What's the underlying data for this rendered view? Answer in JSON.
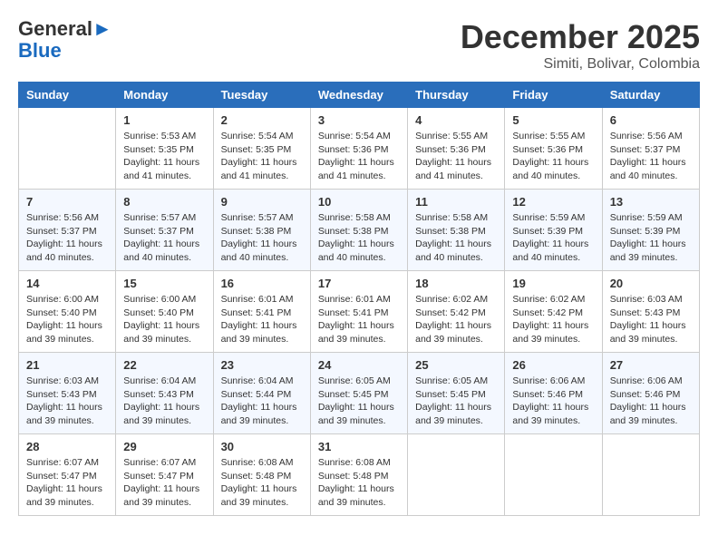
{
  "header": {
    "logo_general": "General",
    "logo_blue": "Blue",
    "month_year": "December 2025",
    "location": "Simiti, Bolivar, Colombia"
  },
  "days_of_week": [
    "Sunday",
    "Monday",
    "Tuesday",
    "Wednesday",
    "Thursday",
    "Friday",
    "Saturday"
  ],
  "weeks": [
    [
      {
        "num": "",
        "info": ""
      },
      {
        "num": "1",
        "info": "Sunrise: 5:53 AM\nSunset: 5:35 PM\nDaylight: 11 hours and 41 minutes."
      },
      {
        "num": "2",
        "info": "Sunrise: 5:54 AM\nSunset: 5:35 PM\nDaylight: 11 hours and 41 minutes."
      },
      {
        "num": "3",
        "info": "Sunrise: 5:54 AM\nSunset: 5:36 PM\nDaylight: 11 hours and 41 minutes."
      },
      {
        "num": "4",
        "info": "Sunrise: 5:55 AM\nSunset: 5:36 PM\nDaylight: 11 hours and 41 minutes."
      },
      {
        "num": "5",
        "info": "Sunrise: 5:55 AM\nSunset: 5:36 PM\nDaylight: 11 hours and 40 minutes."
      },
      {
        "num": "6",
        "info": "Sunrise: 5:56 AM\nSunset: 5:37 PM\nDaylight: 11 hours and 40 minutes."
      }
    ],
    [
      {
        "num": "7",
        "info": "Sunrise: 5:56 AM\nSunset: 5:37 PM\nDaylight: 11 hours and 40 minutes."
      },
      {
        "num": "8",
        "info": "Sunrise: 5:57 AM\nSunset: 5:37 PM\nDaylight: 11 hours and 40 minutes."
      },
      {
        "num": "9",
        "info": "Sunrise: 5:57 AM\nSunset: 5:38 PM\nDaylight: 11 hours and 40 minutes."
      },
      {
        "num": "10",
        "info": "Sunrise: 5:58 AM\nSunset: 5:38 PM\nDaylight: 11 hours and 40 minutes."
      },
      {
        "num": "11",
        "info": "Sunrise: 5:58 AM\nSunset: 5:38 PM\nDaylight: 11 hours and 40 minutes."
      },
      {
        "num": "12",
        "info": "Sunrise: 5:59 AM\nSunset: 5:39 PM\nDaylight: 11 hours and 40 minutes."
      },
      {
        "num": "13",
        "info": "Sunrise: 5:59 AM\nSunset: 5:39 PM\nDaylight: 11 hours and 39 minutes."
      }
    ],
    [
      {
        "num": "14",
        "info": "Sunrise: 6:00 AM\nSunset: 5:40 PM\nDaylight: 11 hours and 39 minutes."
      },
      {
        "num": "15",
        "info": "Sunrise: 6:00 AM\nSunset: 5:40 PM\nDaylight: 11 hours and 39 minutes."
      },
      {
        "num": "16",
        "info": "Sunrise: 6:01 AM\nSunset: 5:41 PM\nDaylight: 11 hours and 39 minutes."
      },
      {
        "num": "17",
        "info": "Sunrise: 6:01 AM\nSunset: 5:41 PM\nDaylight: 11 hours and 39 minutes."
      },
      {
        "num": "18",
        "info": "Sunrise: 6:02 AM\nSunset: 5:42 PM\nDaylight: 11 hours and 39 minutes."
      },
      {
        "num": "19",
        "info": "Sunrise: 6:02 AM\nSunset: 5:42 PM\nDaylight: 11 hours and 39 minutes."
      },
      {
        "num": "20",
        "info": "Sunrise: 6:03 AM\nSunset: 5:43 PM\nDaylight: 11 hours and 39 minutes."
      }
    ],
    [
      {
        "num": "21",
        "info": "Sunrise: 6:03 AM\nSunset: 5:43 PM\nDaylight: 11 hours and 39 minutes."
      },
      {
        "num": "22",
        "info": "Sunrise: 6:04 AM\nSunset: 5:43 PM\nDaylight: 11 hours and 39 minutes."
      },
      {
        "num": "23",
        "info": "Sunrise: 6:04 AM\nSunset: 5:44 PM\nDaylight: 11 hours and 39 minutes."
      },
      {
        "num": "24",
        "info": "Sunrise: 6:05 AM\nSunset: 5:45 PM\nDaylight: 11 hours and 39 minutes."
      },
      {
        "num": "25",
        "info": "Sunrise: 6:05 AM\nSunset: 5:45 PM\nDaylight: 11 hours and 39 minutes."
      },
      {
        "num": "26",
        "info": "Sunrise: 6:06 AM\nSunset: 5:46 PM\nDaylight: 11 hours and 39 minutes."
      },
      {
        "num": "27",
        "info": "Sunrise: 6:06 AM\nSunset: 5:46 PM\nDaylight: 11 hours and 39 minutes."
      }
    ],
    [
      {
        "num": "28",
        "info": "Sunrise: 6:07 AM\nSunset: 5:47 PM\nDaylight: 11 hours and 39 minutes."
      },
      {
        "num": "29",
        "info": "Sunrise: 6:07 AM\nSunset: 5:47 PM\nDaylight: 11 hours and 39 minutes."
      },
      {
        "num": "30",
        "info": "Sunrise: 6:08 AM\nSunset: 5:48 PM\nDaylight: 11 hours and 39 minutes."
      },
      {
        "num": "31",
        "info": "Sunrise: 6:08 AM\nSunset: 5:48 PM\nDaylight: 11 hours and 39 minutes."
      },
      {
        "num": "",
        "info": ""
      },
      {
        "num": "",
        "info": ""
      },
      {
        "num": "",
        "info": ""
      }
    ]
  ]
}
